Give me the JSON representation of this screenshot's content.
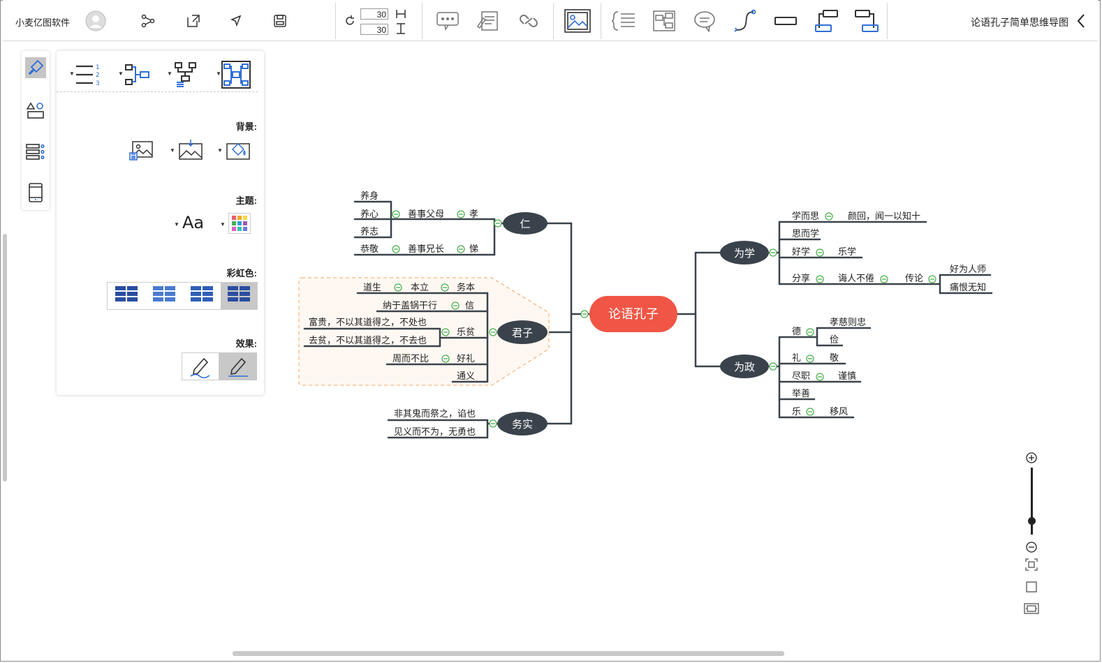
{
  "title": "论语孔子简单思维导图",
  "app_name": "小麦亿图软件",
  "toolbar": {
    "spacing_h": "30",
    "spacing_v": "30"
  },
  "panel": {
    "background_label": "背景:",
    "theme_label": "主题:",
    "rainbow_label": "彩虹色:",
    "effect_label": "效果:",
    "font_sample": "Aa"
  },
  "colors": {
    "root_fill": "#f05545",
    "main_node_fill": "#3a434c",
    "line": "#3a434c",
    "collapse_green": "#4caf50",
    "highlight_border": "#f5a35f",
    "highlight_fill": "#fff8f2",
    "accent_blue": "#2f6fd6"
  },
  "mindmap": {
    "root": "论语孔子",
    "main_nodes": {
      "ren": "仁",
      "junzi": "君子",
      "wushi": "务实",
      "weixue": "为学",
      "weizheng": "为政"
    },
    "ren_branch": {
      "xiao": "孝",
      "shanshi_fumu": "善事父母",
      "yangxin": "养心",
      "yangshen": "养身",
      "yangzhi": "养志",
      "ti": "悌",
      "shanshi_xiongzhang": "善事兄长",
      "gongjing": "恭敬"
    },
    "junzi_branch": {
      "wuben": "务本",
      "benli": "本立",
      "daosheng": "道生",
      "xin": "信",
      "naji": "纳于盖锅干行",
      "leping": "乐贫",
      "fugui": "富贵，不以其道得之，不处也",
      "pinjian": "去贫，不以其道得之，不去也",
      "haoli": "好礼",
      "zhoububi": "周而不比",
      "tongyi": "通义"
    },
    "wushi_branch": {
      "feiqi": "非其鬼而祭之，谄也",
      "jianyi": "见义而不为，无勇也"
    },
    "weixue_branch": {
      "xueersi": "学而思",
      "yanhui": "颜回，闻一以知十",
      "siirxue": "思而学",
      "haoxue": "好学",
      "lexue": "乐学",
      "fenxiang": "分享",
      "huirenbujuan": "诲人不倦",
      "chuanlun": "传论",
      "haoweirenshi": "好为人师",
      "tonghenwuzhi": "痛恨无知"
    },
    "weizheng_branch": {
      "de": "德",
      "xiaocizhong": "孝慈则忠",
      "jian": "俭",
      "li": "礼",
      "jing": "敬",
      "ruji": "尽职",
      "jinxin": "谨慎",
      "juzhuan": "举善",
      "le": "乐",
      "yifeng": "移风"
    }
  }
}
